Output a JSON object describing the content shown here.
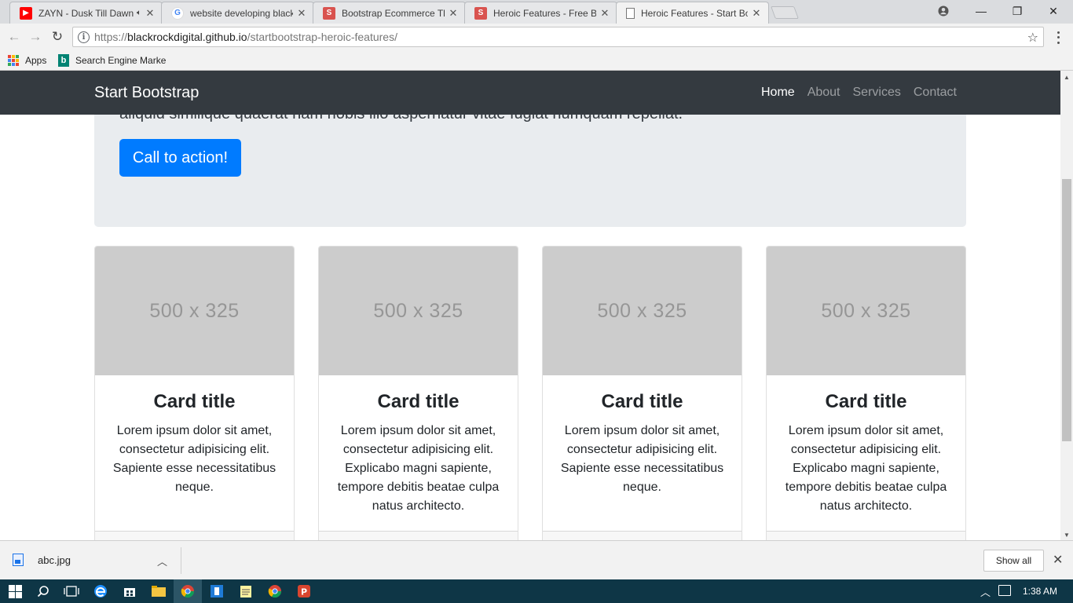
{
  "browser": {
    "tabs": [
      {
        "title": "ZAYN - Dusk Till Dawn",
        "favicon": "youtube-icon",
        "playing": true
      },
      {
        "title": "website developing black",
        "favicon": "google-icon"
      },
      {
        "title": "Bootstrap Ecommerce Th",
        "favicon": "s-icon"
      },
      {
        "title": "Heroic Features - Free Bo",
        "favicon": "s-icon"
      },
      {
        "title": "Heroic Features - Start Bo",
        "favicon": "page-icon",
        "active": true
      }
    ],
    "address": {
      "scheme": "https://",
      "host": "blackrockdigital.github.io",
      "path": "/startbootstrap-heroic-features/"
    },
    "bookmarks": [
      {
        "label": "Apps",
        "icon": "apps-grid-icon"
      },
      {
        "label": "Search Engine Marke",
        "icon": "bing-icon"
      }
    ],
    "colors": {
      "youtube": "#ff0000",
      "s_favicon": "#d9534f"
    }
  },
  "site": {
    "brand": "Start Bootstrap",
    "nav": [
      "Home",
      "About",
      "Services",
      "Contact"
    ],
    "active_nav": "Home",
    "jumbotron": {
      "lead_fragment": "aliquid similique quaerat nam nobis illo aspernatur vitae fugiat numquam repellat.",
      "cta": "Call to action!"
    },
    "cards": [
      {
        "image": "500 x 325",
        "title": "Card title",
        "text": "Lorem ipsum dolor sit amet, consectetur adipisicing elit. Sapiente esse necessitatibus neque."
      },
      {
        "image": "500 x 325",
        "title": "Card title",
        "text": "Lorem ipsum dolor sit amet, consectetur adipisicing elit. Explicabo magni sapiente, tempore debitis beatae culpa natus architecto."
      },
      {
        "image": "500 x 325",
        "title": "Card title",
        "text": "Lorem ipsum dolor sit amet, consectetur adipisicing elit. Sapiente esse necessitatibus neque."
      },
      {
        "image": "500 x 325",
        "title": "Card title",
        "text": "Lorem ipsum dolor sit amet, consectetur adipisicing elit. Explicabo magni sapiente, tempore debitis beatae culpa natus architecto."
      }
    ],
    "colors": {
      "navbar": "#343a40",
      "primary": "#007bff",
      "jumbotron": "#e9ecef"
    }
  },
  "downloads": {
    "file": "abc.jpg",
    "show_all": "Show all"
  },
  "taskbar": {
    "time": "1:38 AM"
  }
}
